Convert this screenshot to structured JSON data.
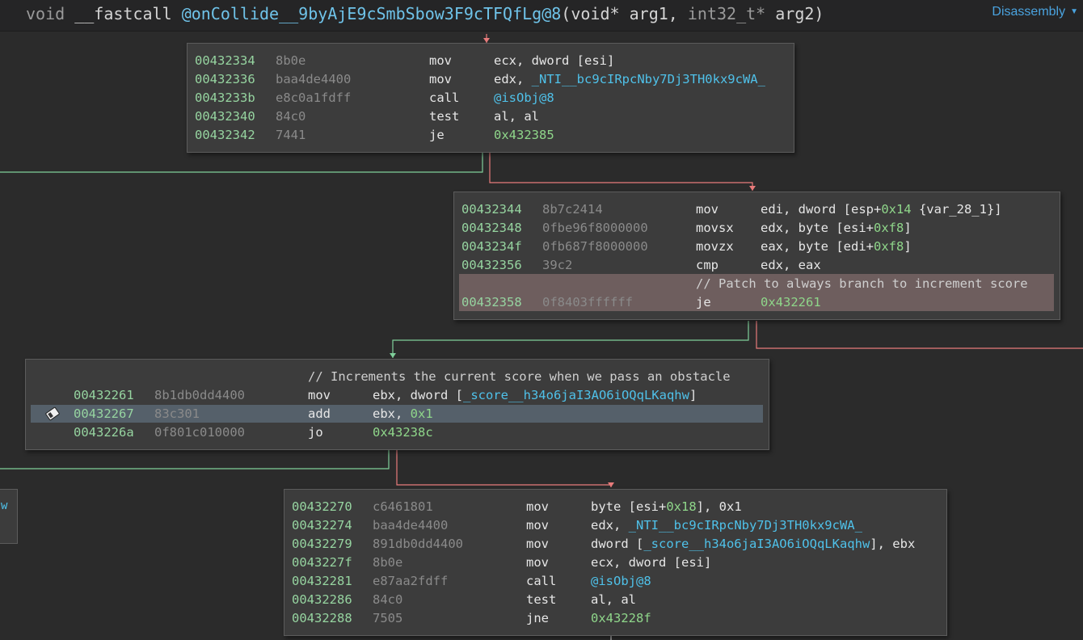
{
  "header": {
    "ret_type": "void",
    "calling_conv": "__fastcall",
    "func_name": "@onCollide__9byAjE9cSmbSbow3F9cTFQfLg@8",
    "open_paren": "(",
    "arg1_type": "void*",
    "arg1_name": "arg1",
    "comma": ",",
    "arg2_type": "int32_t*",
    "arg2_name": "arg2",
    "close_paren": ")",
    "view_label": "Disassembly"
  },
  "blocks": {
    "b1": [
      {
        "addr": "00432334",
        "bytes": "8b0e",
        "mnem": "mov",
        "op_a": "ecx, dword [esi]",
        "op_b": "",
        "op_c": ""
      },
      {
        "addr": "00432336",
        "bytes": "baa4de4400",
        "mnem": "mov",
        "op_a": "edx, ",
        "op_b": "_NTI__bc9cIRpcNby7Dj3TH0kx9cWA_",
        "op_c": ""
      },
      {
        "addr": "0043233b",
        "bytes": "e8c0a1fdff",
        "mnem": "call",
        "op_a": "",
        "op_b": "@isObj@8",
        "op_c": ""
      },
      {
        "addr": "00432340",
        "bytes": "84c0",
        "mnem": "test",
        "op_a": "al, al",
        "op_b": "",
        "op_c": ""
      },
      {
        "addr": "00432342",
        "bytes": "7441",
        "mnem": "je",
        "op_a": "",
        "op_b": "0x432385",
        "op_c": ""
      }
    ],
    "b2": [
      {
        "addr": "00432344",
        "bytes": "8b7c2414",
        "mnem": "mov",
        "op_a": "edi, dword [esp+",
        "op_b": "0x14",
        "op_c": " {var_28_1}]"
      },
      {
        "addr": "00432348",
        "bytes": "0fbe96f8000000",
        "mnem": "movsx",
        "op_a": "edx, byte [esi+",
        "op_b": "0xf8",
        "op_c": "]"
      },
      {
        "addr": "0043234f",
        "bytes": "0fb687f8000000",
        "mnem": "movzx",
        "op_a": "eax, byte [edi+",
        "op_b": "0xf8",
        "op_c": "]"
      },
      {
        "addr": "00432356",
        "bytes": "39c2",
        "mnem": "cmp",
        "op_a": "edx, eax",
        "op_b": "",
        "op_c": ""
      }
    ],
    "b2_comment": "// Patch to always branch to increment score",
    "b2_last": {
      "addr": "00432358",
      "bytes": "0f8403ffffff",
      "mnem": "je",
      "op_b": "0x432261"
    },
    "b3_comment": "// Increments the current score when we pass an obstacle",
    "b3": [
      {
        "addr": "00432261",
        "bytes": "8b1db0dd4400",
        "mnem": "mov",
        "op_a": "ebx, dword [",
        "op_b": "_score__h34o6jaI3AO6iOQqLKaqhw",
        "op_c": "]"
      },
      {
        "addr": "00432267",
        "bytes": "83c301",
        "mnem": "add",
        "op_a": "ebx, ",
        "op_b": "0x1",
        "op_c": ""
      },
      {
        "addr": "0043226a",
        "bytes": "0f801c010000",
        "mnem": "jo",
        "op_a": "",
        "op_b": "0x43238c",
        "op_c": ""
      }
    ],
    "b4": [
      {
        "addr": "00432270",
        "bytes": "c6461801",
        "mnem": "mov",
        "op_a": "byte [esi+",
        "op_b": "0x18",
        "op_c": "], 0x1"
      },
      {
        "addr": "00432274",
        "bytes": "baa4de4400",
        "mnem": "mov",
        "op_a": "edx, ",
        "op_b": "_NTI__bc9cIRpcNby7Dj3TH0kx9cWA_",
        "op_c": ""
      },
      {
        "addr": "00432279",
        "bytes": "891db0dd4400",
        "mnem": "mov",
        "op_a": "dword [",
        "op_b": "_score__h34o6jaI3AO6iOQqLKaqhw",
        "op_c": "], ebx"
      },
      {
        "addr": "0043227f",
        "bytes": "8b0e",
        "mnem": "mov",
        "op_a": "ecx, dword [esi]",
        "op_b": "",
        "op_c": ""
      },
      {
        "addr": "00432281",
        "bytes": "e87aa2fdff",
        "mnem": "call",
        "op_a": "",
        "op_b": "@isObj@8",
        "op_c": ""
      },
      {
        "addr": "00432286",
        "bytes": "84c0",
        "mnem": "test",
        "op_a": "al, al",
        "op_b": "",
        "op_c": ""
      },
      {
        "addr": "00432288",
        "bytes": "7505",
        "mnem": "jne",
        "op_a": "",
        "op_b": "0x43228f",
        "op_c": ""
      }
    ]
  },
  "partial_block_text": "w",
  "colors": {
    "background": "#2b2b2b",
    "block": "#3c3c3c",
    "address": "#96d4a0",
    "symbol": "#4fc1e9",
    "edge_true": "#7fcf9a",
    "edge_false": "#e87b7b",
    "patch_highlight": "#6e5e5e",
    "selected_line": "#55606a"
  }
}
